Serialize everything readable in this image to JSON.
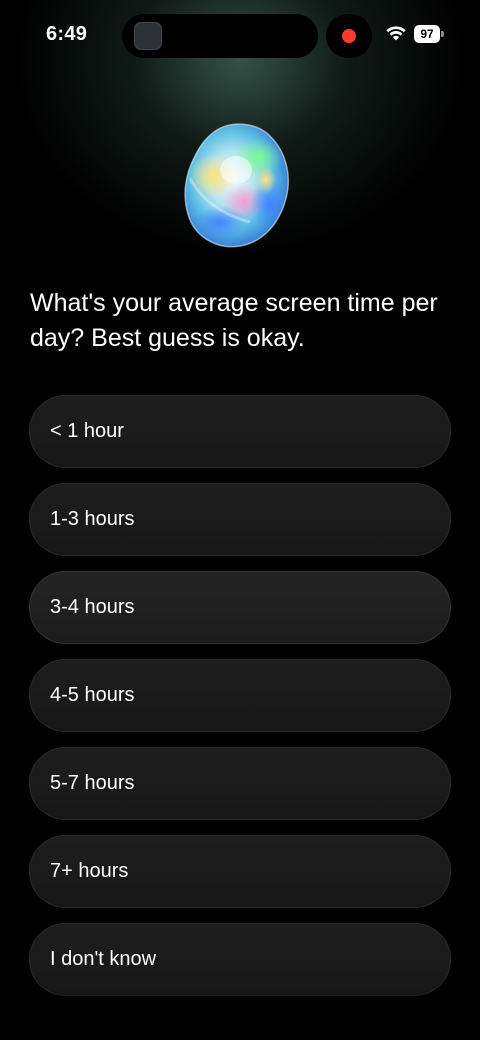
{
  "status_bar": {
    "time": "6:49",
    "battery_level": "97",
    "wifi_icon": "wifi-icon",
    "recording_indicator": "recording-dot-icon"
  },
  "hero": {
    "icon": "opal-gem-icon"
  },
  "question": {
    "text": "What's your average screen time per day? Best guess is okay."
  },
  "options": [
    {
      "label": "< 1 hour"
    },
    {
      "label": "1-3 hours"
    },
    {
      "label": "3-4 hours"
    },
    {
      "label": "4-5 hours"
    },
    {
      "label": "5-7 hours"
    },
    {
      "label": "7+ hours"
    },
    {
      "label": "I don't know"
    }
  ],
  "colors": {
    "background": "#000000",
    "option_background": "#1b1b1b",
    "text": "#ffffff",
    "recording_dot": "#ff3b30"
  }
}
